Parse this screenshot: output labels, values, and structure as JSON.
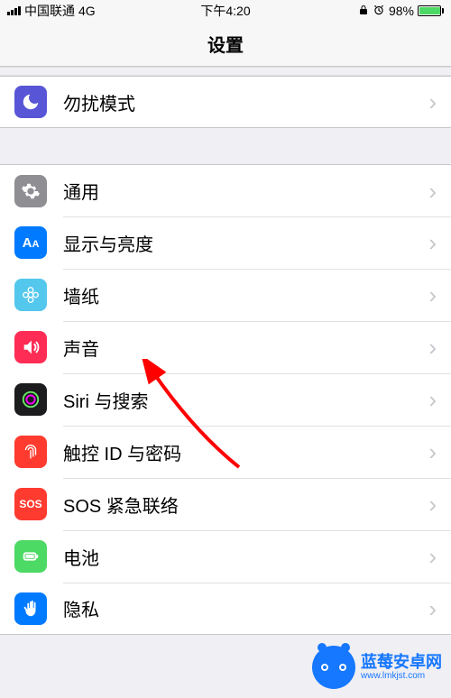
{
  "status_bar": {
    "carrier": "中国联通",
    "network": "4G",
    "time": "下午4:20",
    "lock_icon": "lock",
    "alarm_icon": "alarm",
    "battery_pct": "98%"
  },
  "nav": {
    "title": "设置"
  },
  "groups": [
    {
      "rows": [
        {
          "key": "dnd",
          "label": "勿扰模式",
          "icon": "moon",
          "icon_class": "ic-dnd"
        }
      ]
    },
    {
      "rows": [
        {
          "key": "general",
          "label": "通用",
          "icon": "gear",
          "icon_class": "ic-general"
        },
        {
          "key": "display",
          "label": "显示与亮度",
          "icon": "AA",
          "icon_class": "ic-display"
        },
        {
          "key": "wallpaper",
          "label": "墙纸",
          "icon": "flower",
          "icon_class": "ic-wallpaper"
        },
        {
          "key": "sound",
          "label": "声音",
          "icon": "speaker",
          "icon_class": "ic-sound"
        },
        {
          "key": "siri",
          "label": "Siri 与搜索",
          "icon": "siri",
          "icon_class": "ic-siri"
        },
        {
          "key": "touchid",
          "label": "触控 ID 与密码",
          "icon": "fingerprint",
          "icon_class": "ic-touchid"
        },
        {
          "key": "sos",
          "label": "SOS 紧急联络",
          "icon": "SOS",
          "icon_class": "ic-sos"
        },
        {
          "key": "battery",
          "label": "电池",
          "icon": "battery",
          "icon_class": "ic-battery"
        },
        {
          "key": "privacy",
          "label": "隐私",
          "icon": "hand",
          "icon_class": "ic-privacy"
        }
      ]
    }
  ],
  "watermark": {
    "brand": "蓝莓安卓网",
    "url": "www.lmkjst.com"
  }
}
